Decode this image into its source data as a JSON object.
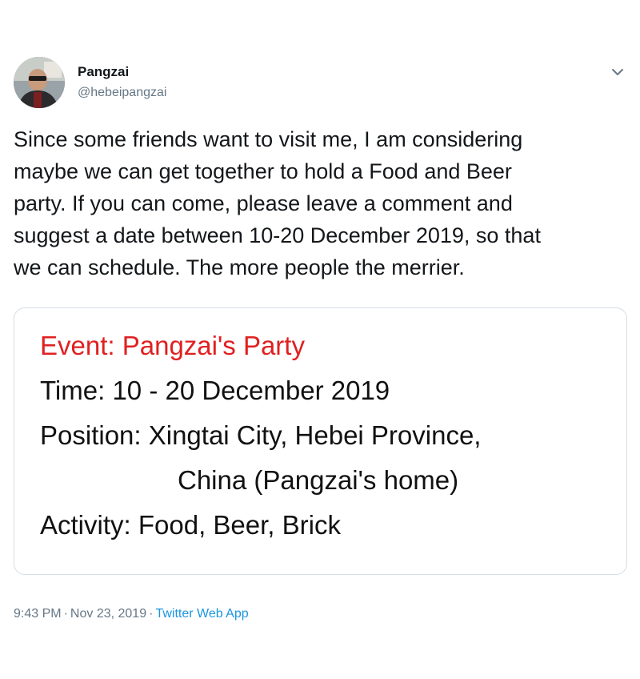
{
  "author": {
    "name": "Pangzai",
    "handle": "@hebeipangzai"
  },
  "tweet": {
    "text_lines": [
      "Since some friends want to visit me, I am considering",
      "maybe we can get together to hold a Food and Beer",
      "party. If you can come, please leave a comment and",
      "suggest a date between 10-20 December 2019, so that",
      "we can schedule. The more people the merrier."
    ]
  },
  "card": {
    "title": "Event: Pangzai's Party",
    "time": "Time: 10 - 20 December 2019",
    "position_line1": "Position: Xingtai City, Hebei Province,",
    "position_line2": "China (Pangzai's home)",
    "activity": "Activity: Food, Beer, Brick",
    "title_color": "#e02020"
  },
  "meta": {
    "time": "9:43 PM",
    "separator": "·",
    "date": "Nov 23, 2019",
    "source": "Twitter Web App"
  },
  "icons": {
    "caret": "chevron-down-icon"
  }
}
